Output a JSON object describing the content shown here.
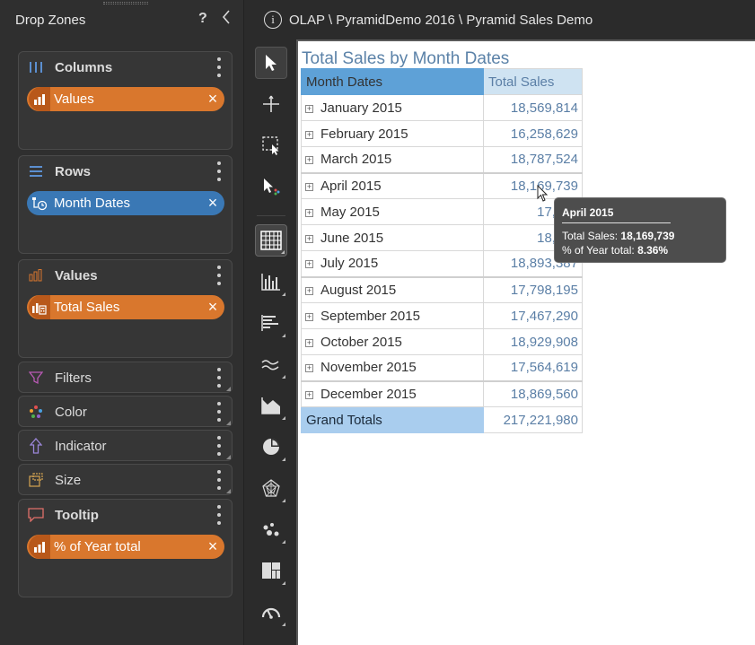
{
  "dropzones": {
    "title": "Drop Zones",
    "help_label": "?",
    "zones": {
      "columns": {
        "label": "Columns",
        "pill": "Values",
        "icon": "columns-icon"
      },
      "rows": {
        "label": "Rows",
        "pill": "Month Dates",
        "icon": "rows-icon"
      },
      "values": {
        "label": "Values",
        "pill": "Total Sales",
        "icon": "values-icon"
      },
      "filters": {
        "label": "Filters",
        "icon": "funnel-icon"
      },
      "color": {
        "label": "Color",
        "icon": "palette-icon"
      },
      "indicator": {
        "label": "Indicator",
        "icon": "arrow-up-icon"
      },
      "size": {
        "label": "Size",
        "icon": "size-icon"
      },
      "tooltip": {
        "label": "Tooltip",
        "pill": "% of Year total",
        "icon": "speech-bubble-icon"
      }
    }
  },
  "breadcrumb": "OLAP \\ PyramidDemo 2016 \\ Pyramid Sales Demo",
  "grid": {
    "title": "Total Sales by Month Dates",
    "col_header_1": "Month Dates",
    "col_header_2": "Total Sales",
    "rows": [
      {
        "label": "January 2015",
        "value": "18,569,814"
      },
      {
        "label": "February 2015",
        "value": "16,258,629"
      },
      {
        "label": "March 2015",
        "value": "18,787,524"
      },
      {
        "label": "April 2015",
        "value": "18,169,739"
      },
      {
        "label": "May 2015",
        "value": "17,854"
      },
      {
        "label": "June 2015",
        "value": "18,058"
      },
      {
        "label": "July 2015",
        "value": "18,893,387"
      },
      {
        "label": "August 2015",
        "value": "17,798,195"
      },
      {
        "label": "September 2015",
        "value": "17,467,290"
      },
      {
        "label": "October 2015",
        "value": "18,929,908"
      },
      {
        "label": "November 2015",
        "value": "17,564,619"
      },
      {
        "label": "December 2015",
        "value": "18,869,560"
      }
    ],
    "grand_total_label": "Grand Totals",
    "grand_total_value": "217,221,980"
  },
  "tooltip": {
    "title": "April 2015",
    "line1_label": "Total Sales:",
    "line1_value": "18,169,739",
    "line2_label": "% of Year total:",
    "line2_value": "8.36%"
  },
  "colors": {
    "pill_orange": "#d9772d",
    "pill_blue": "#3a78b5",
    "header_blue": "#5ea1d7",
    "grand_total_blue": "#a9cdee",
    "value_text": "#5b7fa6"
  }
}
